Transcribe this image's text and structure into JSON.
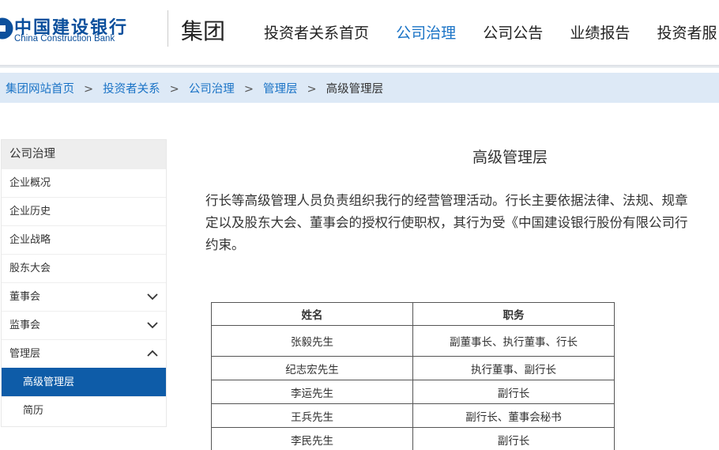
{
  "header": {
    "logo_cn": "中国建设银行",
    "logo_en": "China Construction Bank",
    "group_title": "集团",
    "nav": [
      {
        "label": "投资者关系首页",
        "active": false
      },
      {
        "label": "公司治理",
        "active": true
      },
      {
        "label": "公司公告",
        "active": false
      },
      {
        "label": "业绩报告",
        "active": false
      },
      {
        "label": "投资者服",
        "active": false
      }
    ]
  },
  "breadcrumb": {
    "items": [
      "集团网站首页",
      "投资者关系",
      "公司治理",
      "管理层"
    ],
    "separator": ">",
    "current": "高级管理层"
  },
  "sidebar": {
    "header": "公司治理",
    "items": [
      {
        "label": "企业概况"
      },
      {
        "label": "企业历史"
      },
      {
        "label": "企业战略"
      },
      {
        "label": "股东大会"
      },
      {
        "label": "董事会",
        "chevron": "chevron-down-icon"
      },
      {
        "label": "监事会",
        "chevron": "chevron-down-icon"
      },
      {
        "label": "管理层",
        "chevron": "chevron-up-icon"
      },
      {
        "label": "高级管理层",
        "sub": true,
        "active": true
      },
      {
        "label": "简历",
        "sub": true
      }
    ]
  },
  "main": {
    "title": "高级管理层",
    "intro_lines": [
      "行长等高级管理人员负责组织我行的经营管理活动。行长主要依据法律、法规、规章",
      "定以及股东大会、董事会的授权行使职权，其行为受《中国建设银行股份有限公司行",
      "约束。"
    ],
    "table": {
      "headers": [
        "姓名",
        "职务"
      ],
      "rows": [
        [
          "张毅先生",
          "副董事长、执行董事、行长"
        ],
        [
          "纪志宏先生",
          "执行董事、副行长"
        ],
        [
          "李运先生",
          "副行长"
        ],
        [
          "王兵先生",
          "副行长、董事会秘书"
        ],
        [
          "李民先生",
          "副行长"
        ]
      ]
    }
  },
  "colors": {
    "brand_blue": "#0b4f9c",
    "link_blue": "#1a73c6",
    "active_blue": "#0e5ca8",
    "breadcrumb_bg": "#dde9f6"
  }
}
